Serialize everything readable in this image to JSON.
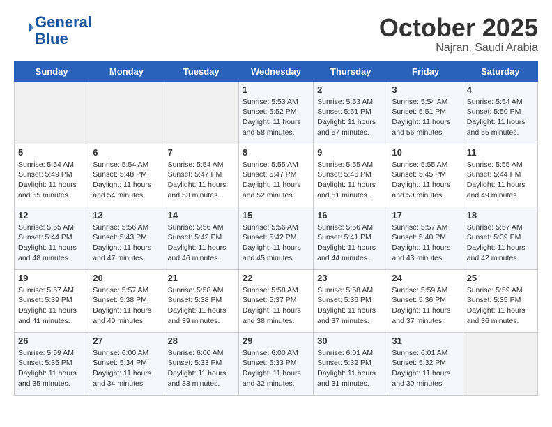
{
  "header": {
    "logo_line1": "General",
    "logo_line2": "Blue",
    "month": "October 2025",
    "location": "Najran, Saudi Arabia"
  },
  "days_of_week": [
    "Sunday",
    "Monday",
    "Tuesday",
    "Wednesday",
    "Thursday",
    "Friday",
    "Saturday"
  ],
  "weeks": [
    [
      {
        "day": "",
        "info": ""
      },
      {
        "day": "",
        "info": ""
      },
      {
        "day": "",
        "info": ""
      },
      {
        "day": "1",
        "info": "Sunrise: 5:53 AM\nSunset: 5:52 PM\nDaylight: 11 hours\nand 58 minutes."
      },
      {
        "day": "2",
        "info": "Sunrise: 5:53 AM\nSunset: 5:51 PM\nDaylight: 11 hours\nand 57 minutes."
      },
      {
        "day": "3",
        "info": "Sunrise: 5:54 AM\nSunset: 5:51 PM\nDaylight: 11 hours\nand 56 minutes."
      },
      {
        "day": "4",
        "info": "Sunrise: 5:54 AM\nSunset: 5:50 PM\nDaylight: 11 hours\nand 55 minutes."
      }
    ],
    [
      {
        "day": "5",
        "info": "Sunrise: 5:54 AM\nSunset: 5:49 PM\nDaylight: 11 hours\nand 55 minutes."
      },
      {
        "day": "6",
        "info": "Sunrise: 5:54 AM\nSunset: 5:48 PM\nDaylight: 11 hours\nand 54 minutes."
      },
      {
        "day": "7",
        "info": "Sunrise: 5:54 AM\nSunset: 5:47 PM\nDaylight: 11 hours\nand 53 minutes."
      },
      {
        "day": "8",
        "info": "Sunrise: 5:55 AM\nSunset: 5:47 PM\nDaylight: 11 hours\nand 52 minutes."
      },
      {
        "day": "9",
        "info": "Sunrise: 5:55 AM\nSunset: 5:46 PM\nDaylight: 11 hours\nand 51 minutes."
      },
      {
        "day": "10",
        "info": "Sunrise: 5:55 AM\nSunset: 5:45 PM\nDaylight: 11 hours\nand 50 minutes."
      },
      {
        "day": "11",
        "info": "Sunrise: 5:55 AM\nSunset: 5:44 PM\nDaylight: 11 hours\nand 49 minutes."
      }
    ],
    [
      {
        "day": "12",
        "info": "Sunrise: 5:55 AM\nSunset: 5:44 PM\nDaylight: 11 hours\nand 48 minutes."
      },
      {
        "day": "13",
        "info": "Sunrise: 5:56 AM\nSunset: 5:43 PM\nDaylight: 11 hours\nand 47 minutes."
      },
      {
        "day": "14",
        "info": "Sunrise: 5:56 AM\nSunset: 5:42 PM\nDaylight: 11 hours\nand 46 minutes."
      },
      {
        "day": "15",
        "info": "Sunrise: 5:56 AM\nSunset: 5:42 PM\nDaylight: 11 hours\nand 45 minutes."
      },
      {
        "day": "16",
        "info": "Sunrise: 5:56 AM\nSunset: 5:41 PM\nDaylight: 11 hours\nand 44 minutes."
      },
      {
        "day": "17",
        "info": "Sunrise: 5:57 AM\nSunset: 5:40 PM\nDaylight: 11 hours\nand 43 minutes."
      },
      {
        "day": "18",
        "info": "Sunrise: 5:57 AM\nSunset: 5:39 PM\nDaylight: 11 hours\nand 42 minutes."
      }
    ],
    [
      {
        "day": "19",
        "info": "Sunrise: 5:57 AM\nSunset: 5:39 PM\nDaylight: 11 hours\nand 41 minutes."
      },
      {
        "day": "20",
        "info": "Sunrise: 5:57 AM\nSunset: 5:38 PM\nDaylight: 11 hours\nand 40 minutes."
      },
      {
        "day": "21",
        "info": "Sunrise: 5:58 AM\nSunset: 5:38 PM\nDaylight: 11 hours\nand 39 minutes."
      },
      {
        "day": "22",
        "info": "Sunrise: 5:58 AM\nSunset: 5:37 PM\nDaylight: 11 hours\nand 38 minutes."
      },
      {
        "day": "23",
        "info": "Sunrise: 5:58 AM\nSunset: 5:36 PM\nDaylight: 11 hours\nand 37 minutes."
      },
      {
        "day": "24",
        "info": "Sunrise: 5:59 AM\nSunset: 5:36 PM\nDaylight: 11 hours\nand 37 minutes."
      },
      {
        "day": "25",
        "info": "Sunrise: 5:59 AM\nSunset: 5:35 PM\nDaylight: 11 hours\nand 36 minutes."
      }
    ],
    [
      {
        "day": "26",
        "info": "Sunrise: 5:59 AM\nSunset: 5:35 PM\nDaylight: 11 hours\nand 35 minutes."
      },
      {
        "day": "27",
        "info": "Sunrise: 6:00 AM\nSunset: 5:34 PM\nDaylight: 11 hours\nand 34 minutes."
      },
      {
        "day": "28",
        "info": "Sunrise: 6:00 AM\nSunset: 5:33 PM\nDaylight: 11 hours\nand 33 minutes."
      },
      {
        "day": "29",
        "info": "Sunrise: 6:00 AM\nSunset: 5:33 PM\nDaylight: 11 hours\nand 32 minutes."
      },
      {
        "day": "30",
        "info": "Sunrise: 6:01 AM\nSunset: 5:32 PM\nDaylight: 11 hours\nand 31 minutes."
      },
      {
        "day": "31",
        "info": "Sunrise: 6:01 AM\nSunset: 5:32 PM\nDaylight: 11 hours\nand 30 minutes."
      },
      {
        "day": "",
        "info": ""
      }
    ]
  ]
}
